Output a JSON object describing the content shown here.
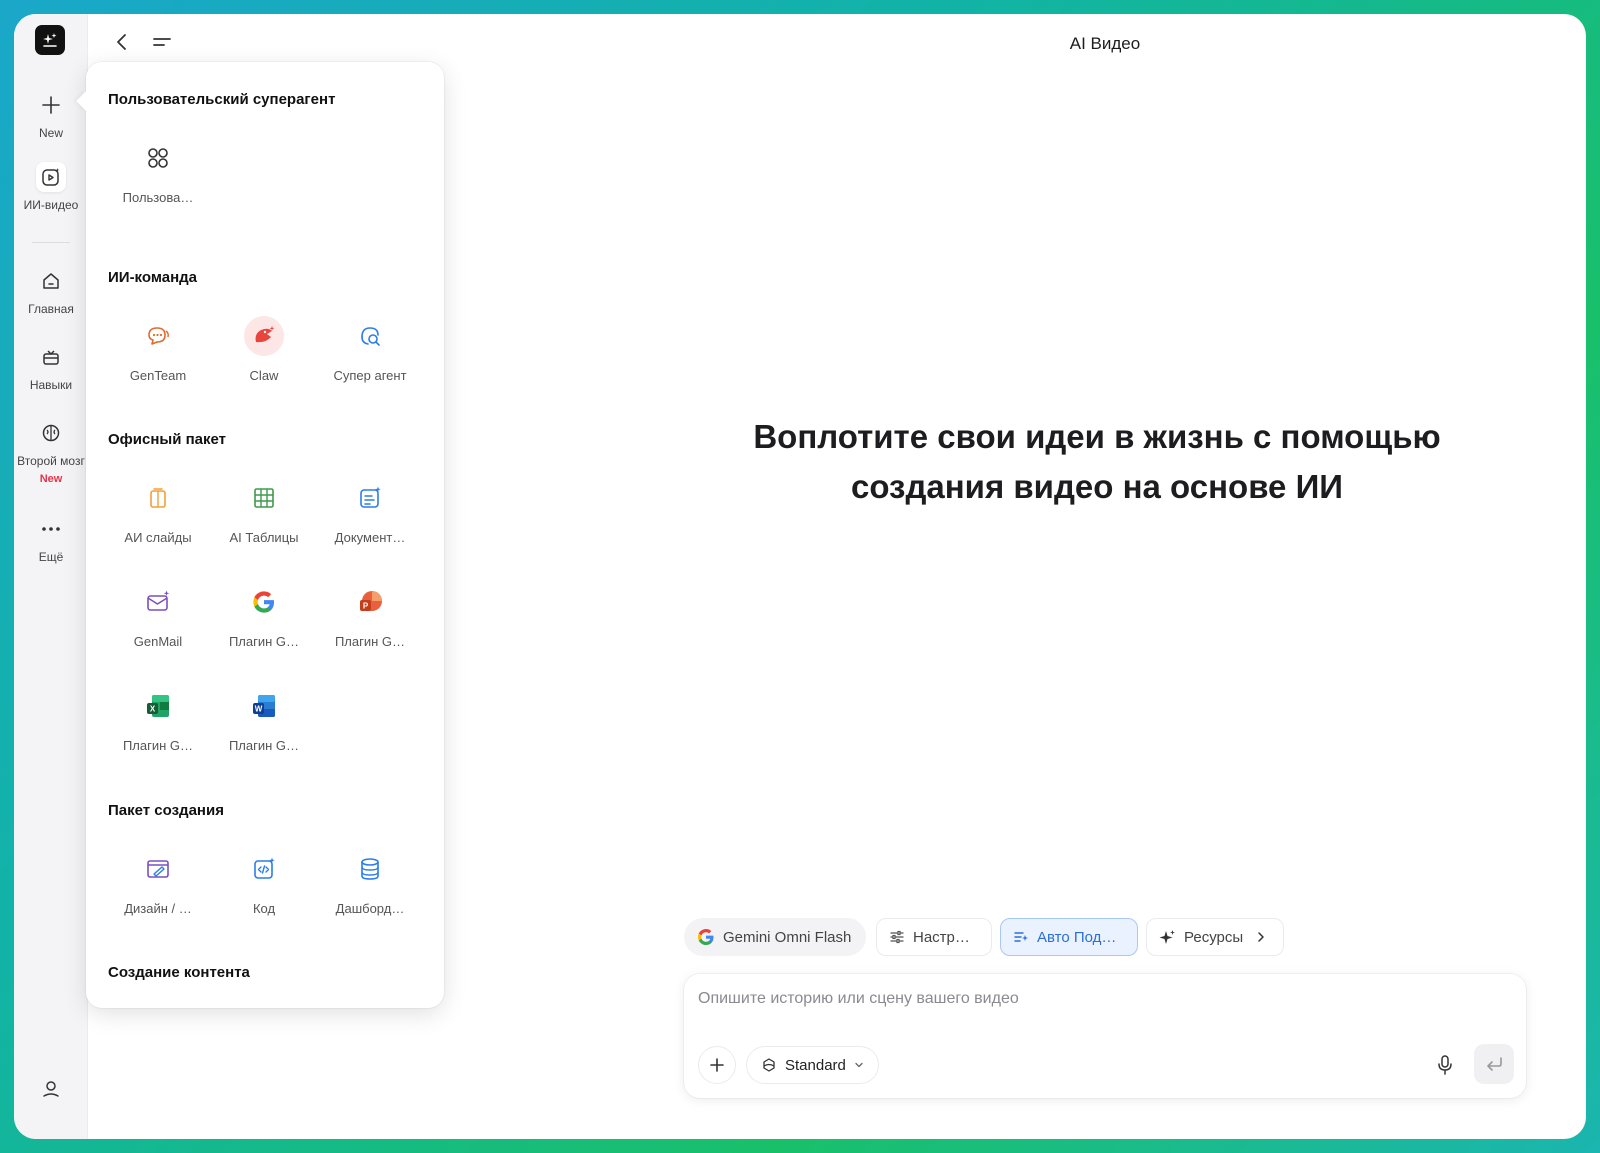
{
  "app": {
    "title": "AI Видео"
  },
  "rail": {
    "items": [
      {
        "label": "New",
        "icon": "plus-icon"
      },
      {
        "label": "ИИ-видео",
        "icon": "video-sparkle-icon"
      },
      {
        "label": "Главная",
        "icon": "home-icon"
      },
      {
        "label": "Навыки",
        "icon": "skills-icon"
      },
      {
        "label": "Второй мозг",
        "icon": "brain-icon",
        "badge": "New"
      },
      {
        "label": "Ещё",
        "icon": "more-icon"
      }
    ]
  },
  "panel": {
    "sections": [
      {
        "title": "Пользовательский суперагент",
        "items": [
          {
            "label": "Пользова…",
            "icon": "grid-circles-icon"
          }
        ]
      },
      {
        "title": "ИИ-команда",
        "items": [
          {
            "label": "GenTeam",
            "icon": "genteam-chat-icon"
          },
          {
            "label": "Claw",
            "icon": "claw-icon"
          },
          {
            "label": "Супер агент",
            "icon": "super-agent-icon"
          }
        ]
      },
      {
        "title": "Офисный пакет",
        "items": [
          {
            "label": "АИ слайды",
            "icon": "slides-icon"
          },
          {
            "label": "AI Таблицы",
            "icon": "sheets-icon"
          },
          {
            "label": "Документ…",
            "icon": "docs-icon"
          },
          {
            "label": "GenMail",
            "icon": "mail-icon"
          },
          {
            "label": "Плагин G…",
            "icon": "google-icon"
          },
          {
            "label": "Плагин G…",
            "icon": "powerpoint-icon"
          },
          {
            "label": "Плагин G…",
            "icon": "excel-icon"
          },
          {
            "label": "Плагин G…",
            "icon": "word-icon"
          }
        ]
      },
      {
        "title": "Пакет создания",
        "items": [
          {
            "label": "Дизайн / …",
            "icon": "design-icon"
          },
          {
            "label": "Код",
            "icon": "code-icon"
          },
          {
            "label": "Дашборд…",
            "icon": "database-icon"
          }
        ]
      },
      {
        "title": "Создание контента",
        "items": []
      }
    ]
  },
  "main": {
    "hero_line1": "Воплотите свои идеи в жизнь с помощью",
    "hero_line2": "создания видео на основе ИИ"
  },
  "chips": [
    {
      "label": "Gemini Omni Flash",
      "icon": "google-icon"
    },
    {
      "label": "Настр…",
      "icon": "sliders-icon"
    },
    {
      "label": "Авто Под…",
      "icon": "auto-list-icon",
      "active": true
    },
    {
      "label": "Ресурсы",
      "icon": "sparkle-icon"
    }
  ],
  "composer": {
    "placeholder": "Опишите историю или сцену вашего видео",
    "mode_label": "Standard"
  },
  "colors": {
    "accent": "#2b6fd6",
    "badge": "#e8334a"
  }
}
